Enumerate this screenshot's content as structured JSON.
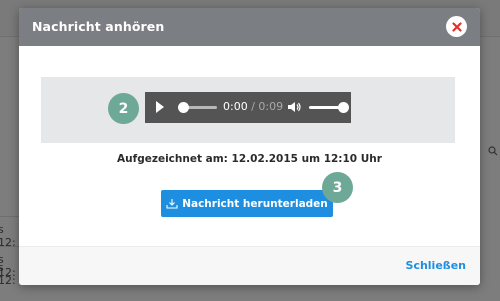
{
  "background": {
    "row_texts": [
      "s 12:",
      "s 12:",
      "s 12:"
    ]
  },
  "modal": {
    "title": "Nachricht anhören",
    "close_icon": "close-icon"
  },
  "player": {
    "current_time": "0:00",
    "separator": " / ",
    "duration": "0:09",
    "progress": 0.0,
    "volume": 1.0
  },
  "badges": {
    "step_player": "2",
    "step_download": "3"
  },
  "recorded_text": "Aufgezeichnet am: 12.02.2015 um 12:10 Uhr",
  "download_button_label": "Nachricht herunterladen",
  "footer": {
    "close_label": "Schließen"
  },
  "colors": {
    "accent": "#1e8fe0",
    "badge": "#6ea896",
    "header": "#7b7e82",
    "close_x": "#e0322c"
  }
}
